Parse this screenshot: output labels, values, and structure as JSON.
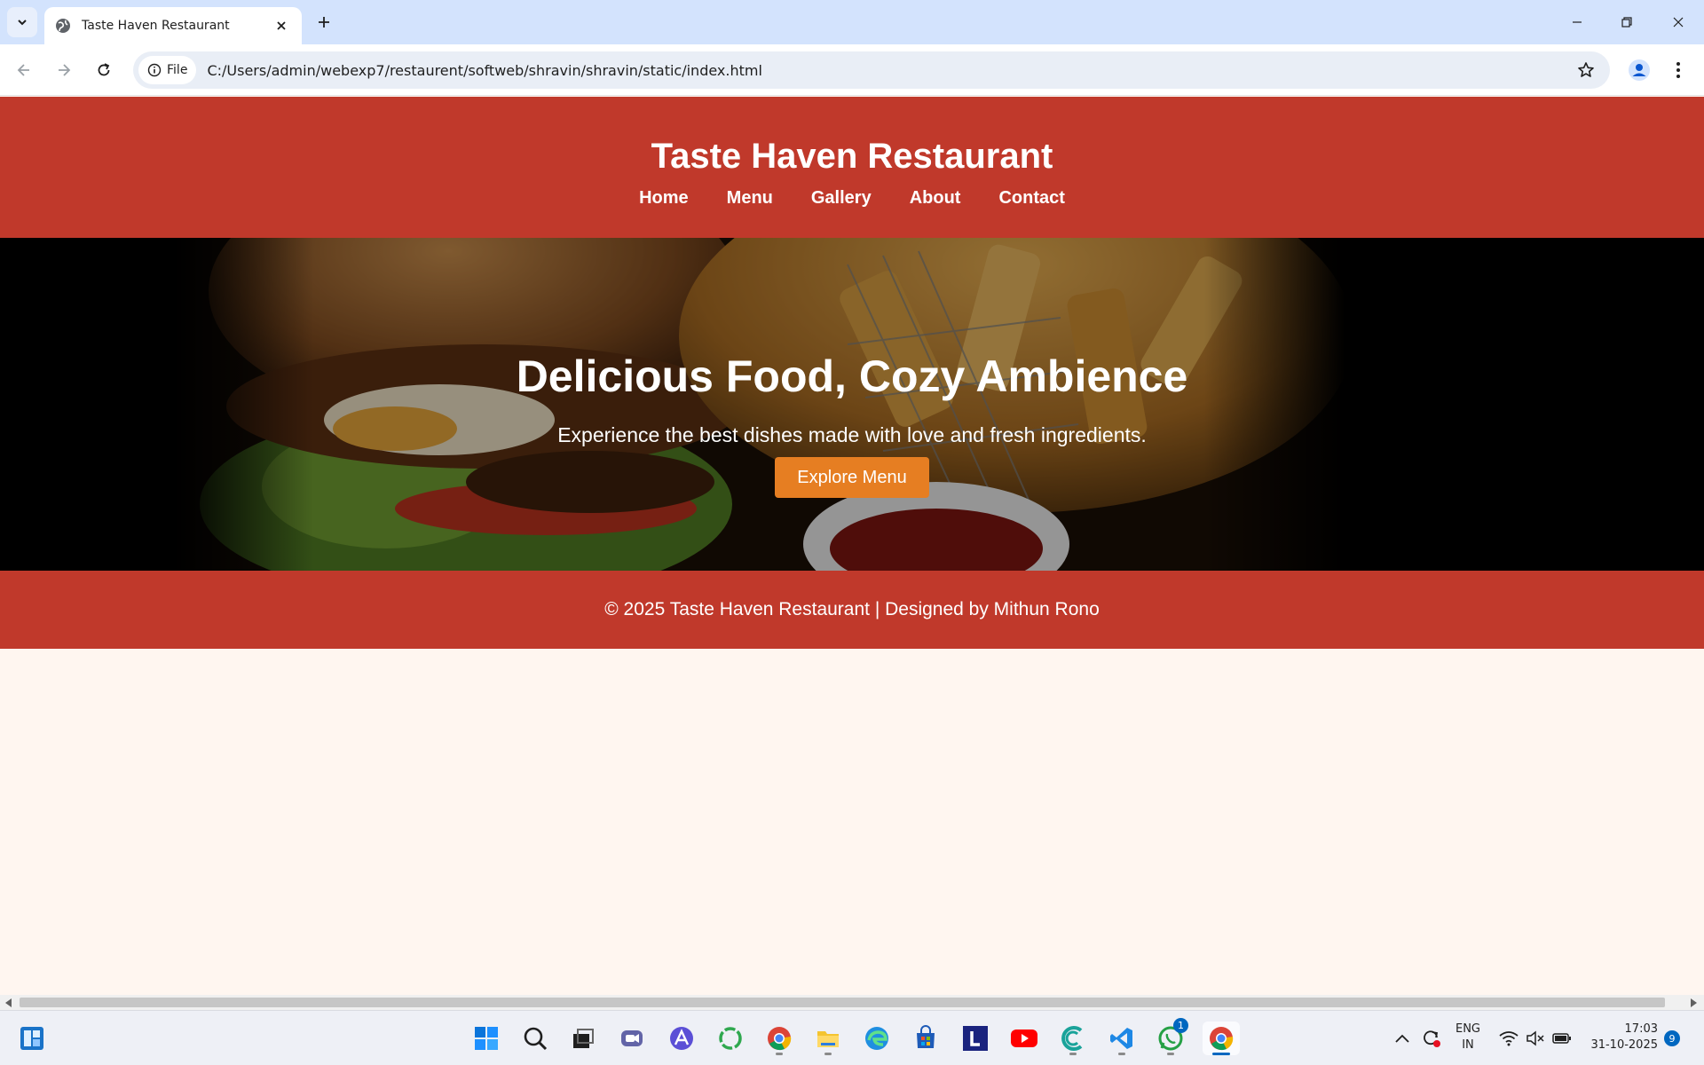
{
  "browser": {
    "tab_title": "Taste Haven Restaurant",
    "file_chip_label": "File",
    "url": "C:/Users/admin/webexp7/restaurent/softweb/shravin/shravin/static/index.html"
  },
  "site": {
    "title": "Taste Haven Restaurant",
    "nav": [
      "Home",
      "Menu",
      "Gallery",
      "About",
      "Contact"
    ],
    "hero": {
      "title": "Delicious Food, Cozy Ambience",
      "subtitle": "Experience the best dishes made with love and fresh ingredients.",
      "button_label": "Explore Menu"
    },
    "footer_text": "© 2025 Taste Haven Restaurant | Designed by Mithun Rono",
    "colors": {
      "primary": "#c0392b",
      "accent": "#e67e22",
      "background": "#fff6f0"
    }
  },
  "taskbar": {
    "icons": [
      "widgets-icon",
      "start-icon",
      "search-icon",
      "task-view-icon",
      "meet-icon",
      "copilot-icon",
      "refresh-app-icon",
      "chrome-icon",
      "file-explorer-icon",
      "edge-icon",
      "store-icon",
      "l-app-icon",
      "youtube-icon",
      "arc-icon",
      "vscode-icon",
      "whatsapp-icon",
      "chrome-active-icon"
    ],
    "whatsapp_badge": "1",
    "language_line1": "ENG",
    "language_line2": "IN",
    "time": "17:03",
    "date": "31-10-2025",
    "notification_count": "9"
  }
}
